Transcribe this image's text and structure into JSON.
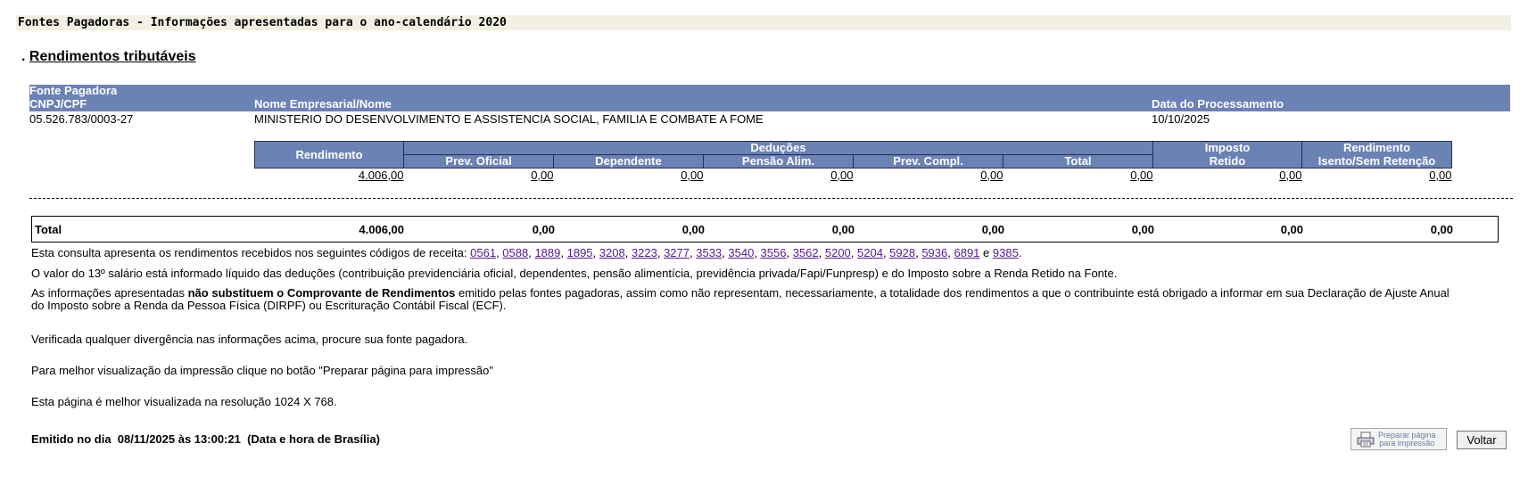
{
  "title": "Fontes Pagadoras - Informações apresentadas para o ano-calendário 2020",
  "section_prefix": ". ",
  "section_title": "Rendimentos tributáveis",
  "header": {
    "fonte_pagadora": "Fonte Pagadora",
    "cnpj_cpf": "CNPJ/CPF",
    "nome": "Nome Empresarial/Nome",
    "data_processamento": "Data do Processamento"
  },
  "source": {
    "cnpj": "05.526.783/0003-27",
    "nome": "MINISTERIO DO DESENVOLVIMENTO E ASSISTENCIA SOCIAL, FAMILIA E COMBATE A FOME",
    "data": "10/10/2025"
  },
  "deductions_table": {
    "rendimento": "Rendimento",
    "deducoes": "Deduções",
    "prev_oficial": "Prev. Oficial",
    "dependente": "Dependente",
    "pensao": "Pensão Alim.",
    "prev_compl": "Prev. Compl.",
    "total": "Total",
    "imposto_l1": "Imposto",
    "imposto_l2": "Retido",
    "isento_l1": "Rendimento",
    "isento_l2": "Isento/Sem Retenção",
    "values": [
      "4.006,00",
      "0,00",
      "0,00",
      "0,00",
      "0,00",
      "0,00",
      "0,00",
      "0,00"
    ]
  },
  "total_row": {
    "label": "Total",
    "values": [
      "4.006,00",
      "0,00",
      "0,00",
      "0,00",
      "0,00",
      "0,00",
      "0,00",
      "0,00"
    ]
  },
  "info": {
    "codes_text": "Esta consulta apresenta os rendimentos recebidos nos seguintes códigos de receita: ",
    "codes": [
      "0561",
      "0588",
      "1889",
      "1895",
      "3208",
      "3223",
      "3277",
      "3533",
      "3540",
      "3556",
      "3562",
      "5200",
      "5204",
      "5928",
      "5936",
      "6891",
      "9385"
    ],
    "codes_and": " e ",
    "codes_end": ".",
    "decimo": "O valor do 13º salário está informado líquido das deduções (contribuição previdenciária oficial, dependentes, pensão alimentícia, previdência privada/Fapi/Funpresp) e do Imposto sobre a Renda Retido na Fonte.",
    "comprovante_a": "As informações apresentadas ",
    "comprovante_b": "não substituem o Comprovante de Rendimentos",
    "comprovante_c": " emitido pelas fontes pagadoras, assim como não representam, necessariamente, a totalidade dos rendimentos a que o contribuinte está obrigado a informar em sua Declaração de Ajuste Anual",
    "comprovante_d": "do Imposto sobre a Renda da Pessoa Física (DIRPF) ou Escrituração Contábil Fiscal (ECF).",
    "divergencia": "Verificada qualquer divergência nas informações acima, procure sua fonte pagadora.",
    "impressao": "Para melhor visualização da impressão clique no botão \"Preparar página para impressão\"",
    "resolucao": "Esta página é melhor visualizada na resolução 1024 X 768."
  },
  "emitido": "Emitido no dia  08/11/2025 às 13:00:21  (Data e hora de Brasília)",
  "buttons": {
    "print_l1": "Preparar página",
    "print_l2": "para impressão",
    "voltar": "Voltar"
  }
}
